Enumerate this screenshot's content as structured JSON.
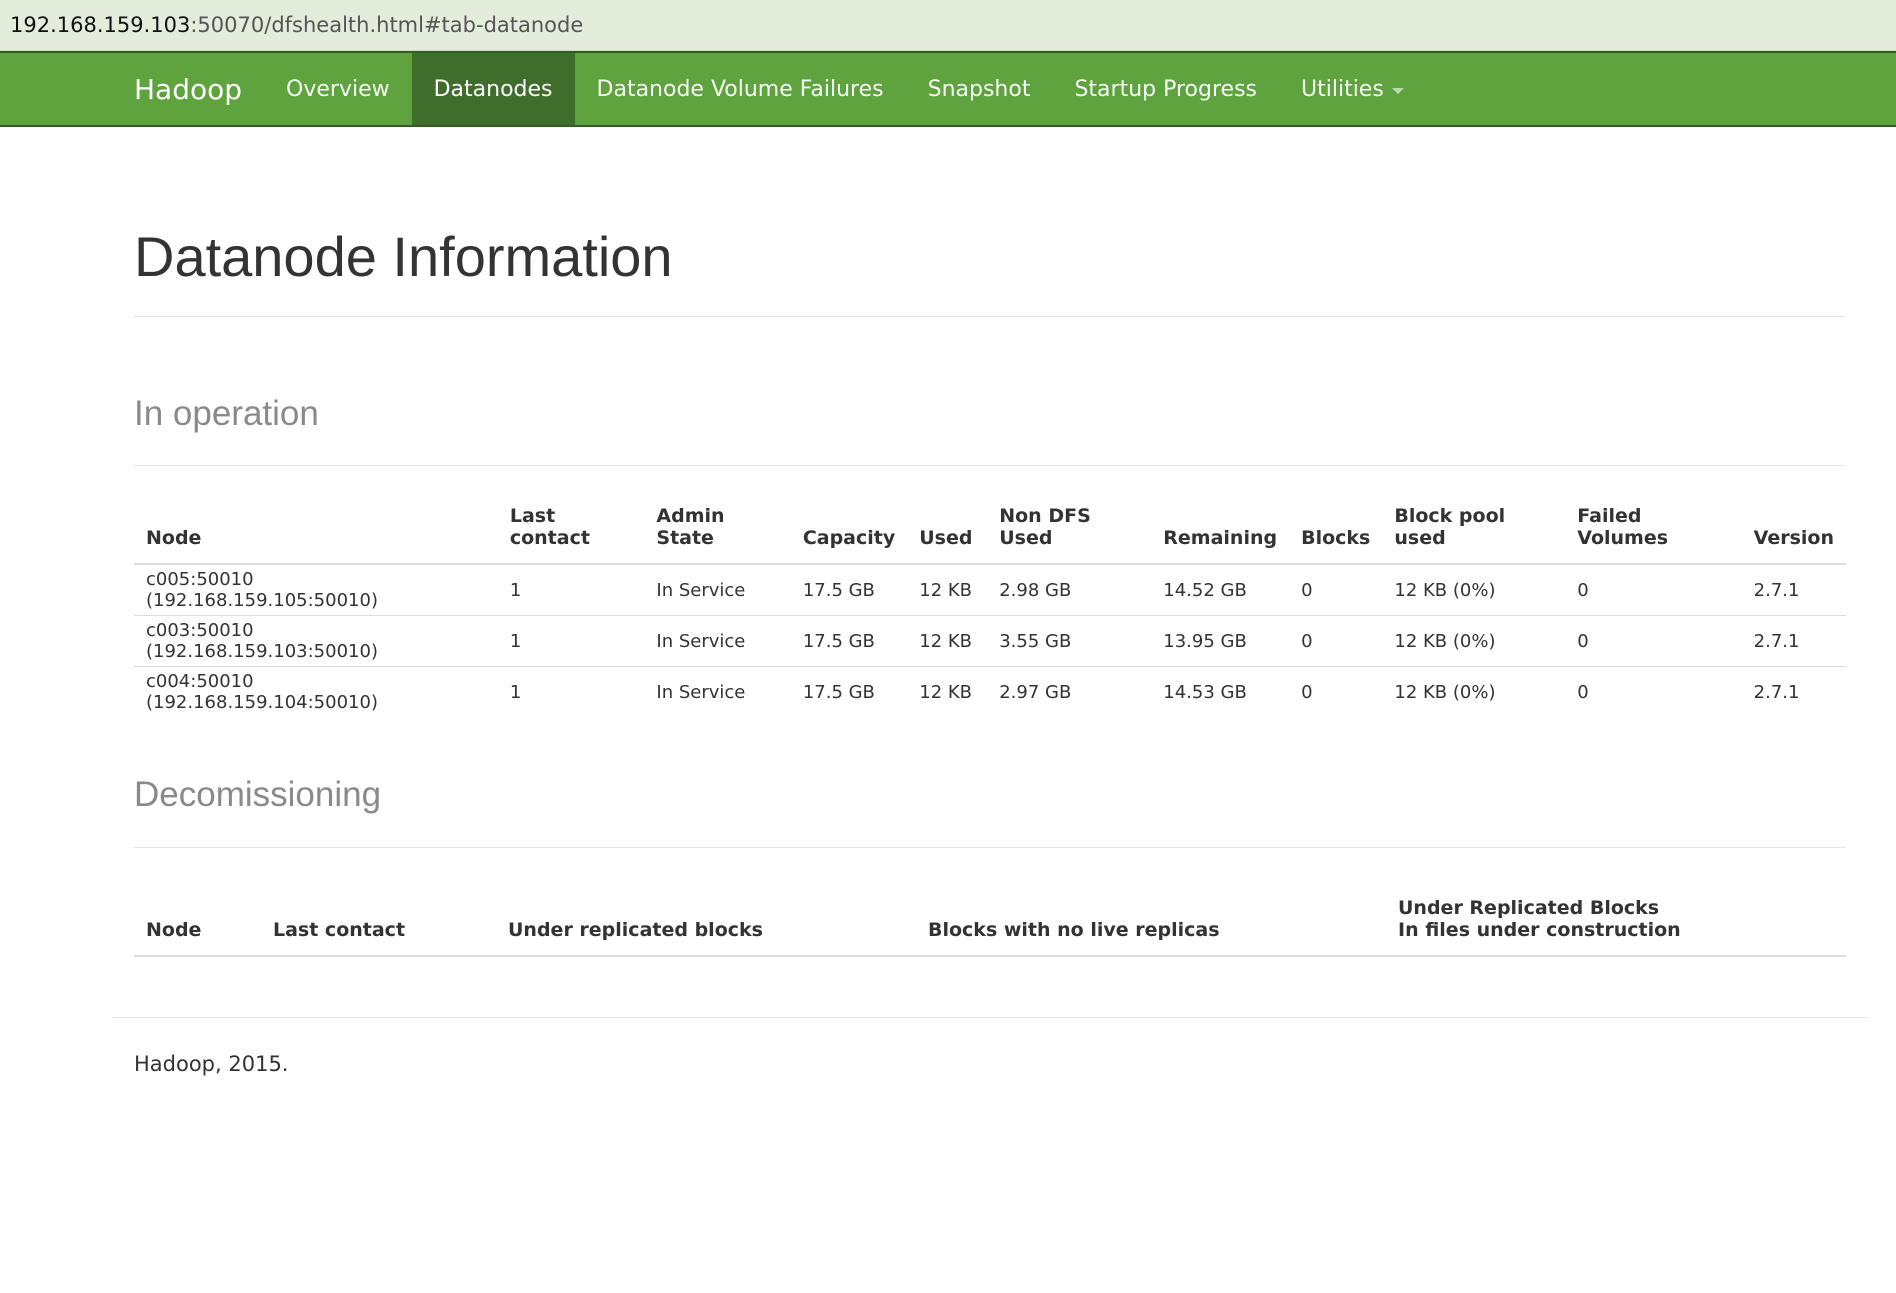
{
  "browser": {
    "url_host": "192.168.159.103",
    "url_rest": ":50070/dfshealth.html#tab-datanode"
  },
  "nav": {
    "brand": "Hadoop",
    "items": [
      "Overview",
      "Datanodes",
      "Datanode Volume Failures",
      "Snapshot",
      "Startup Progress",
      "Utilities"
    ],
    "active": "Datanodes"
  },
  "page": {
    "title": "Datanode Information"
  },
  "in_operation": {
    "heading": "In operation",
    "columns": [
      "Node",
      "Last contact",
      "Admin State",
      "Capacity",
      "Used",
      "Non DFS Used",
      "Remaining",
      "Blocks",
      "Block pool used",
      "Failed Volumes",
      "Version"
    ],
    "rows": [
      [
        "c005:50010 (192.168.159.105:50010)",
        "1",
        "In Service",
        "17.5 GB",
        "12 KB",
        "2.98 GB",
        "14.52 GB",
        "0",
        "12 KB (0%)",
        "0",
        "2.7.1"
      ],
      [
        "c003:50010 (192.168.159.103:50010)",
        "1",
        "In Service",
        "17.5 GB",
        "12 KB",
        "3.55 GB",
        "13.95 GB",
        "0",
        "12 KB (0%)",
        "0",
        "2.7.1"
      ],
      [
        "c004:50010 (192.168.159.104:50010)",
        "1",
        "In Service",
        "17.5 GB",
        "12 KB",
        "2.97 GB",
        "14.53 GB",
        "0",
        "12 KB (0%)",
        "0",
        "2.7.1"
      ]
    ]
  },
  "decomissioning": {
    "heading": "Decomissioning",
    "columns": [
      "Node",
      "Last contact",
      "Under replicated blocks",
      "Blocks with no live replicas",
      "Under Replicated Blocks",
      "In files under construction"
    ]
  },
  "footer": {
    "text": "Hadoop, 2015."
  }
}
